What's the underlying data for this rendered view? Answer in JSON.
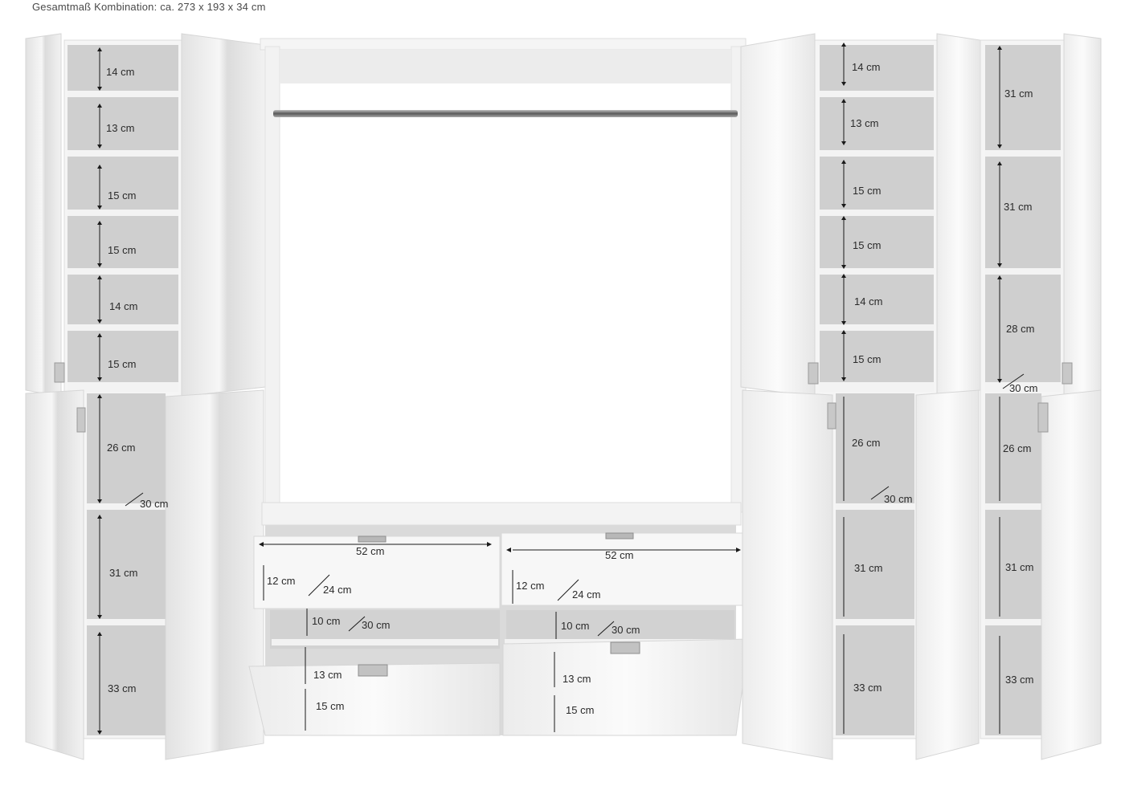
{
  "header": {
    "title": "Gesamtmaß Kombination: ca. 273 x 193 x 34 cm"
  },
  "colors": {
    "interior": "#cfcfcf",
    "shelf": "#f4f4f4",
    "door": "#f7f7f7",
    "outline": "#d9d9d9",
    "dimension": "#1a1a1a"
  },
  "left_cabinet": {
    "upper": [
      "14 cm",
      "13 cm",
      "15 cm",
      "15 cm",
      "14 cm",
      "15 cm"
    ],
    "lower": [
      "26 cm",
      "31 cm",
      "33 cm"
    ],
    "depth": "30 cm"
  },
  "center": {
    "drawer_left": {
      "width": "52 cm",
      "height": "12 cm",
      "depth": "24 cm"
    },
    "drawer_right": {
      "width": "52 cm",
      "height": "12 cm",
      "depth": "24 cm"
    },
    "open_shelf_left": {
      "height": "10 cm",
      "depth": "30 cm"
    },
    "open_shelf_right": {
      "height": "10 cm",
      "depth": "30 cm"
    },
    "shoe_left": [
      "13 cm",
      "15 cm"
    ],
    "shoe_right": [
      "13 cm",
      "15 cm"
    ]
  },
  "right_cabinet_a": {
    "upper": [
      "14 cm",
      "13 cm",
      "15 cm",
      "15 cm",
      "14 cm",
      "15 cm"
    ],
    "lower": [
      "26 cm",
      "31 cm",
      "33 cm"
    ],
    "depth": "30 cm"
  },
  "right_cabinet_b": {
    "upper": [
      "31 cm",
      "31 cm",
      "28 cm"
    ],
    "lower": [
      "26 cm",
      "31 cm",
      "33 cm"
    ],
    "depth": "30 cm"
  }
}
